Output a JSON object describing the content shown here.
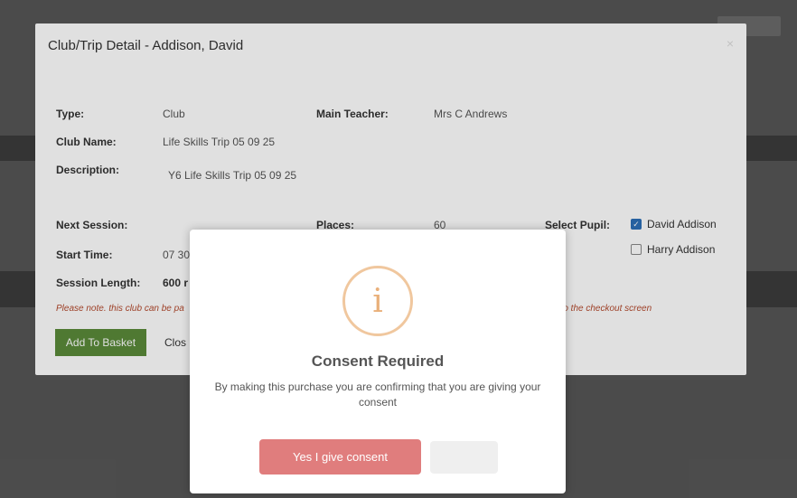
{
  "modal": {
    "title": "Club/Trip Detail - Addison, David",
    "close_symbol": "×"
  },
  "details": {
    "type_label": "Type:",
    "type_value": "Club",
    "club_name_label": "Club Name:",
    "club_name_value": "Life Skills Trip 05 09 25",
    "description_label": "Description:",
    "description_value": "Y6 Life Skills Trip 05 09 25",
    "main_teacher_label": "Main Teacher:",
    "main_teacher_value": "Mrs C Andrews",
    "next_session_label": "Next Session:",
    "places_label": "Places:",
    "places_value": "60",
    "start_time_label": "Start Time:",
    "start_time_value": "07 30",
    "session_length_label": "Session Length:",
    "session_length_value": "600 r",
    "select_pupil_label": "Select Pupil:"
  },
  "pupils": [
    {
      "name": "David Addison",
      "checked": true
    },
    {
      "name": "Harry Addison",
      "checked": false
    }
  ],
  "note": {
    "left": "Please note. this club can be pa",
    "right": "st to the checkout screen"
  },
  "buttons": {
    "add_to_basket": "Add To Basket",
    "close": "Clos"
  },
  "consent": {
    "icon": "info-icon",
    "icon_glyph": "i",
    "title": "Consent Required",
    "message": "By making this purchase you are confirming that you are giving your consent",
    "confirm_label": "Yes I give consent"
  },
  "colors": {
    "basket_button": "#5a8a3a",
    "consent_button": "#e07d7d",
    "info_ring": "#f0c79e",
    "note_text": "#b44a2e",
    "checkbox_checked": "#2c6fb7"
  }
}
